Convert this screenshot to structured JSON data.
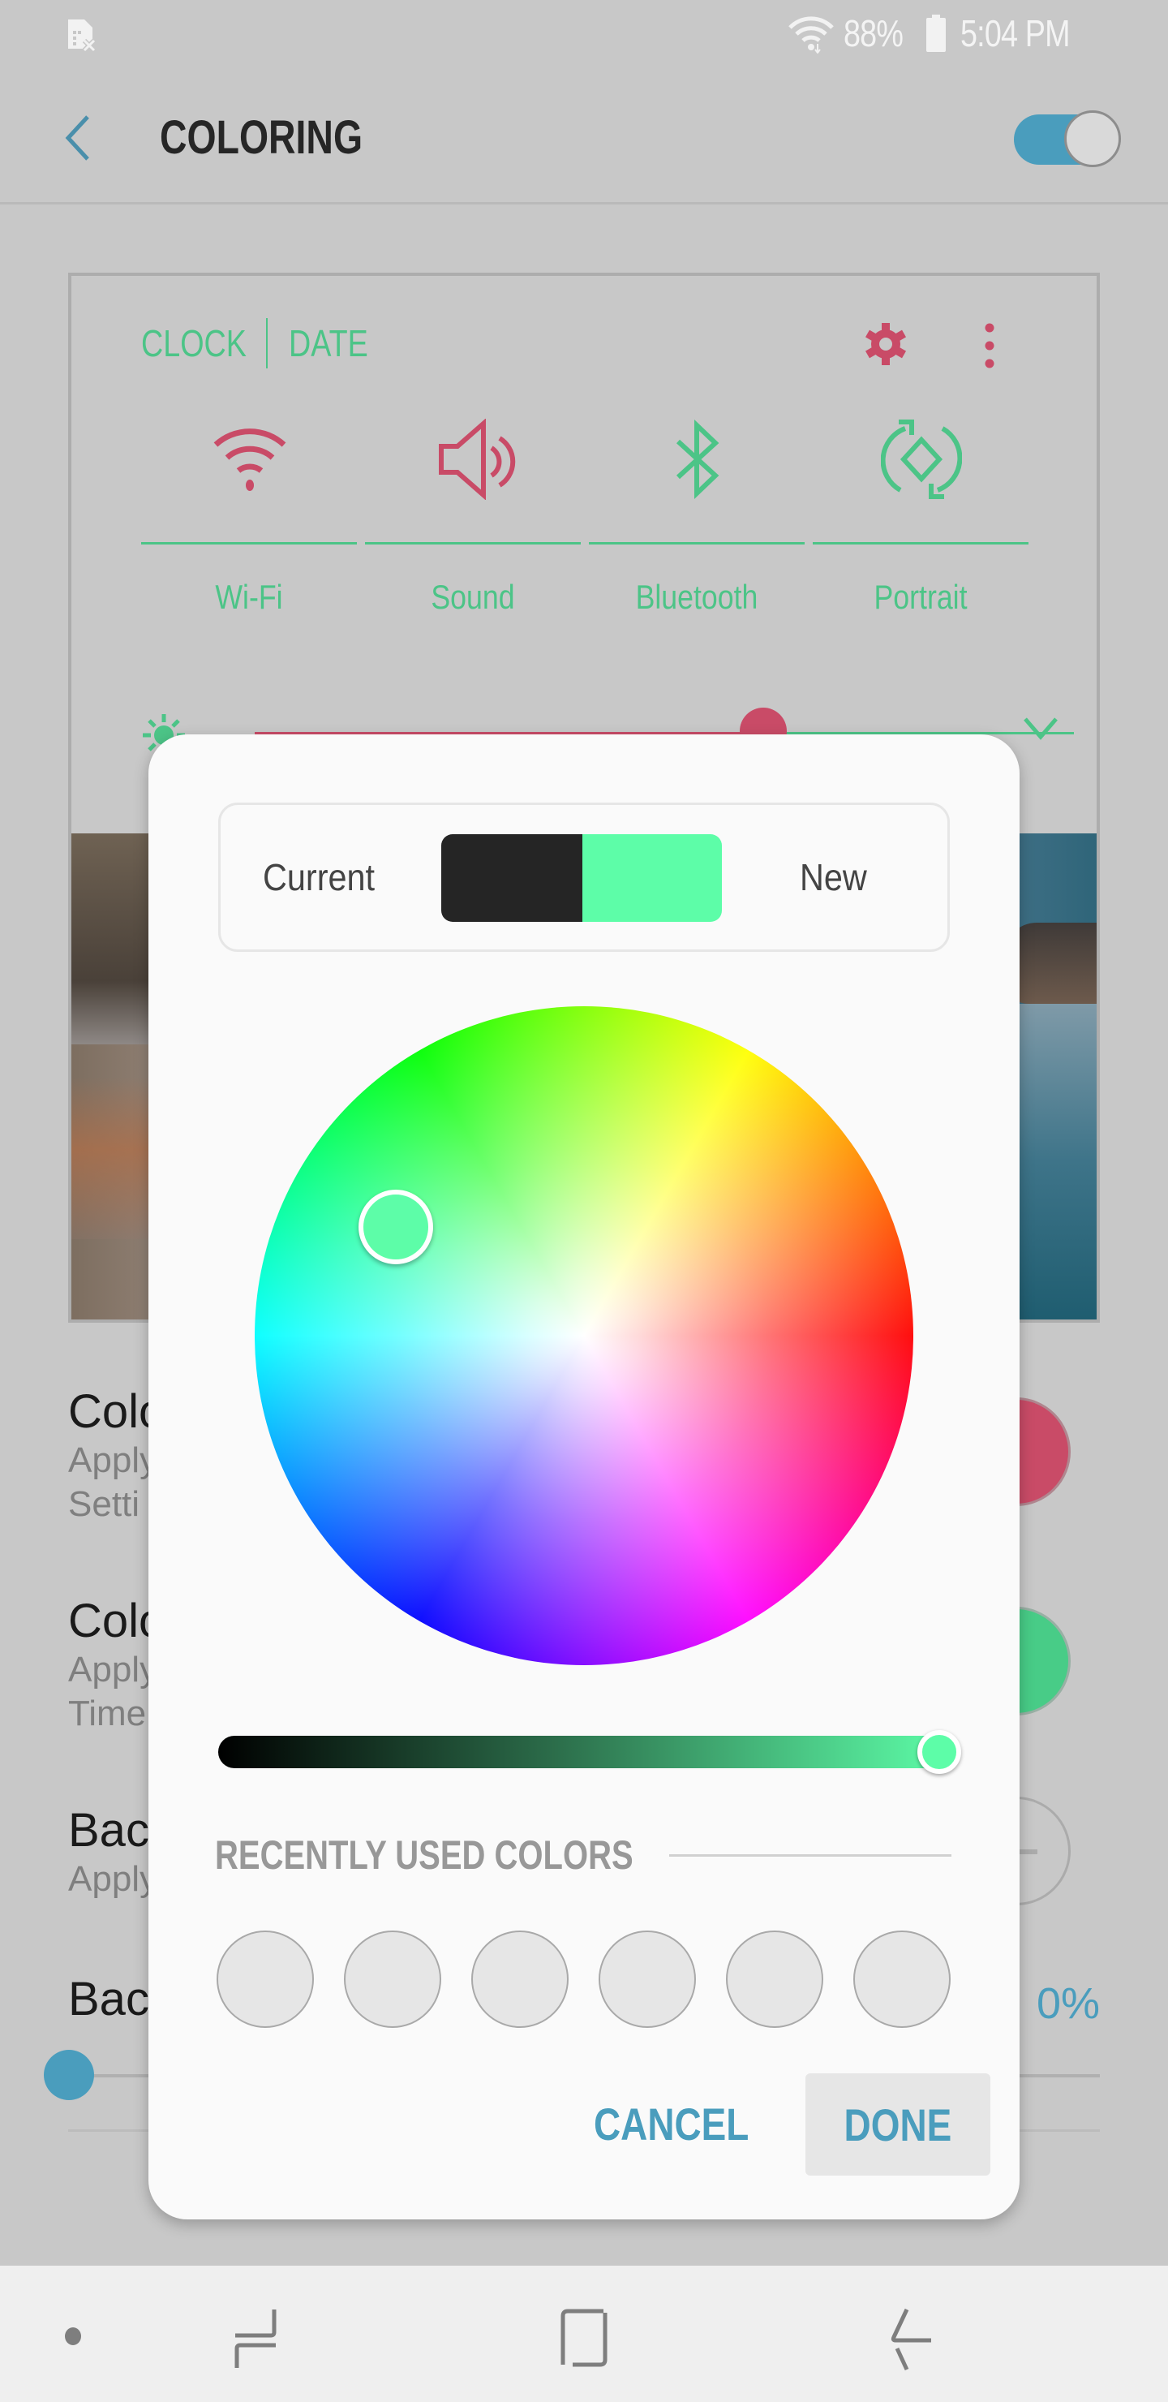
{
  "status_bar": {
    "left_icon": "no-sim-icon",
    "battery_percent": "88%",
    "time": "5:04 PM",
    "icons": [
      "wifi-icon",
      "battery-icon"
    ]
  },
  "header": {
    "back_icon": "back-arrow-icon",
    "title": "COLORING",
    "master_toggle_on": true
  },
  "preview": {
    "tabs": [
      "CLOCK",
      "DATE"
    ],
    "settings_icon": "gear-icon",
    "more_icon": "more-vert-icon",
    "quick_tiles": [
      {
        "label": "Wi-Fi",
        "icon": "wifi-icon"
      },
      {
        "label": "Sound",
        "icon": "speaker-icon"
      },
      {
        "label": "Bluetooth",
        "icon": "bluetooth-icon"
      },
      {
        "label": "Portrait",
        "icon": "rotate-icon"
      }
    ],
    "brightness_level": 0.62,
    "colors": {
      "icon_color": "#c94b67",
      "text_color": "#4cc487"
    }
  },
  "background_settings": [
    {
      "title": "Colo",
      "subtitle_lines": [
        "Apply",
        "Setti"
      ],
      "swatch_color": "#c94b67"
    },
    {
      "title": "Colo",
      "subtitle_lines": [
        "Apply",
        "Time"
      ],
      "swatch_color": "#48cc87"
    },
    {
      "title": "Bac",
      "subtitle_lines": [
        "Apply"
      ],
      "swatch_color": null
    },
    {
      "title": "Bac",
      "value": "0%",
      "slider_level": 0.0
    }
  ],
  "dialog": {
    "current_label": "Current",
    "new_label": "New",
    "current_color": "#252525",
    "new_color": "#5dfda8",
    "wheel_selection": {
      "hue_deg": 150,
      "saturation": 0.66
    },
    "brightness_level": 1.0,
    "recent_label": "RECENTLY USED COLORS",
    "recent_colors": [
      "",
      "",
      "",
      "",
      "",
      ""
    ],
    "cancel_label": "CANCEL",
    "done_label": "DONE"
  },
  "nav_bar": {
    "items": [
      "dot-icon",
      "recents-icon",
      "home-icon",
      "back-icon"
    ]
  }
}
